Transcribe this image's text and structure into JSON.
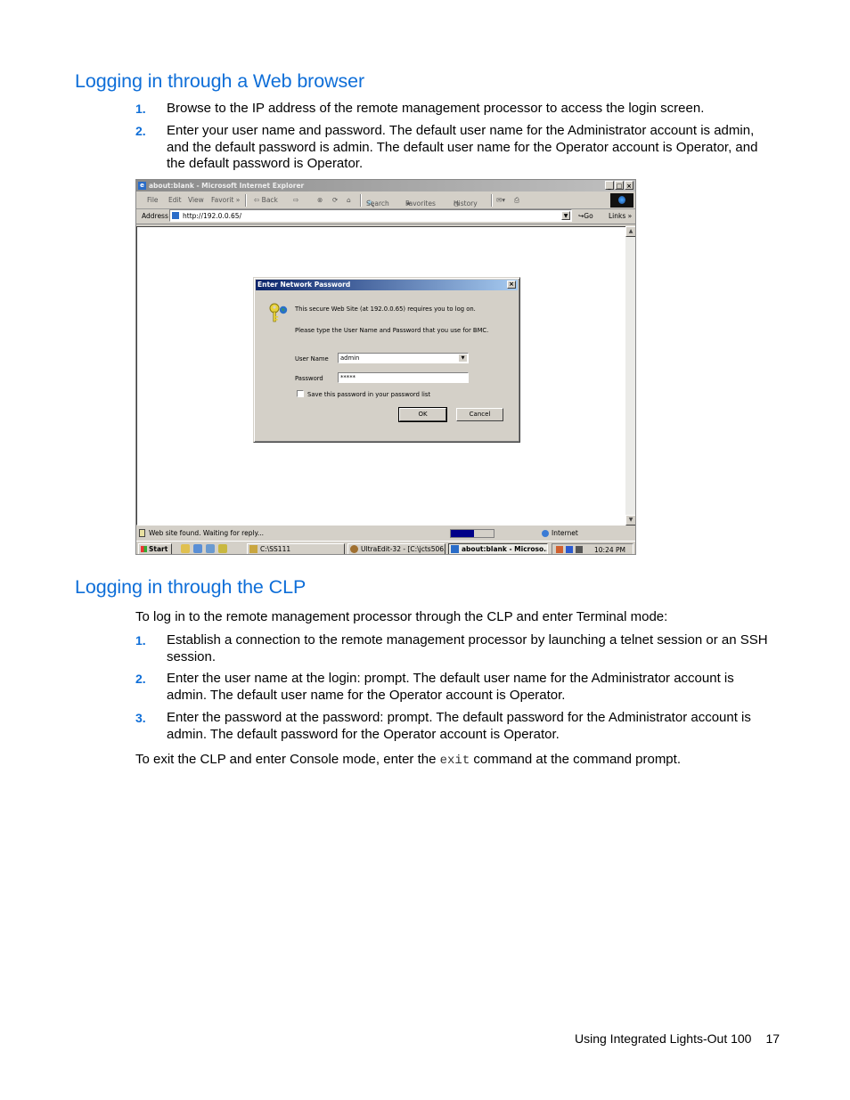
{
  "section1": {
    "heading": "Logging in through a Web browser",
    "steps": [
      {
        "num": "1.",
        "text": "Browse to the IP address of the remote management processor to access the login screen."
      },
      {
        "num": "2.",
        "text": "Enter your user name and password. The default user name for the Administrator account is admin, and the default password is admin. The default user name for the Operator account is Operator, and the default password is Operator."
      }
    ]
  },
  "screenshot": {
    "window_title": "about:blank - Microsoft Internet Explorer",
    "window_buttons": [
      "_",
      "□",
      "×"
    ],
    "menu": [
      "File",
      "Edit",
      "View",
      "Favorit »"
    ],
    "toolbar": {
      "back": "⇦ Back",
      "forward": "⇨",
      "search": "Search",
      "favorites": "Favorites",
      "history": "History"
    },
    "address": {
      "label": "Address",
      "value": "http://192.0.0.65/",
      "go": "Go",
      "links": "Links »"
    },
    "status": {
      "text": "Web site found. Waiting for reply...",
      "progress_percent": 55,
      "zone": "Internet"
    },
    "taskbar": {
      "start": "Start",
      "tasks": [
        "C:\\SS111",
        "UltraEdit-32 - [C:\\jcts506...",
        "about:blank - Microso..."
      ],
      "clock": "10:24 PM"
    },
    "dialog": {
      "title": "Enter Network Password",
      "close": "×",
      "line1": "This secure Web Site (at 192.0.0.65) requires you to log on.",
      "line2": "Please type the User Name and Password that you use for BMC.",
      "username_label": "User Name",
      "username_value": "admin",
      "password_label": "Password",
      "password_value": "*****",
      "save_label": "Save this password in your password list",
      "save_checked": false,
      "ok": "OK",
      "cancel": "Cancel"
    }
  },
  "section2": {
    "heading": "Logging in through the CLP",
    "intro": "To log in to the remote management processor through the CLP and enter Terminal mode:",
    "steps": [
      {
        "num": "1.",
        "text": "Establish a connection to the remote management processor by launching a telnet session or an SSH session."
      },
      {
        "num": "2.",
        "text": "Enter the user name at the login: prompt. The default user name for the Administrator account is admin. The default user name for the Operator account is Operator."
      },
      {
        "num": "3.",
        "text": "Enter the password at the password: prompt. The default password for the Administrator account is admin. The default password for the Operator account is Operator."
      }
    ],
    "exit_before": "To exit the CLP and enter Console mode, enter the ",
    "exit_code": "exit",
    "exit_after": " command at the command prompt."
  },
  "footer": {
    "title": "Using Integrated Lights-Out 100",
    "page": "17"
  }
}
